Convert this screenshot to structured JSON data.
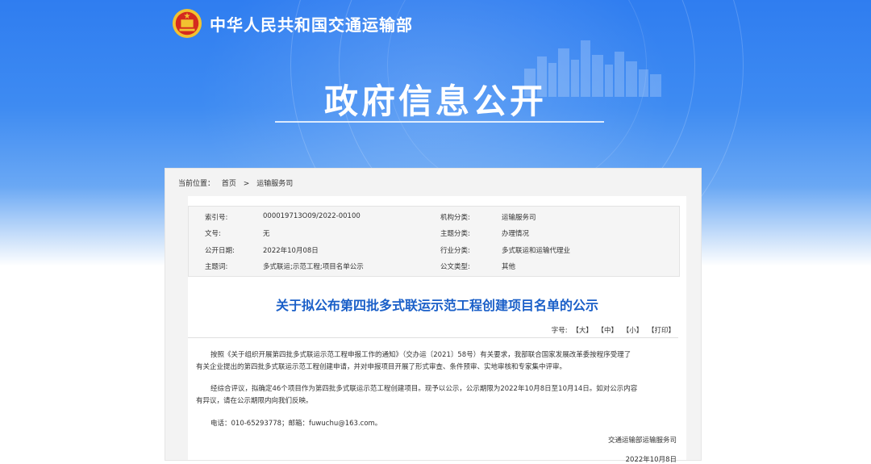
{
  "header": {
    "site_title": "中华人民共和国交通运输部",
    "big_title": "政府信息公开"
  },
  "breadcrumb": {
    "label": "当前位置：",
    "home": "首页",
    "separator": ">",
    "current": "运输服务司"
  },
  "meta": {
    "index_label": "索引号:",
    "index_value": "000019713O09/2022-00100",
    "org_label": "机构分类:",
    "org_value": "运输服务司",
    "docno_label": "文号:",
    "docno_value": "无",
    "topic_label": "主题分类:",
    "topic_value": "办理情况",
    "date_label": "公开日期:",
    "date_value": "2022年10月08日",
    "industry_label": "行业分类:",
    "industry_value": "多式联运和运输代理业",
    "keywords_label": "主题词:",
    "keywords_value": "多式联运;示范工程;项目名单公示",
    "doctype_label": "公文类型:",
    "doctype_value": "其他"
  },
  "document": {
    "title": "关于拟公布第四批多式联运示范工程创建项目名单的公示",
    "font_size_label": "字号:",
    "font_large": "【大】",
    "font_medium": "【中】",
    "font_small": "【小】",
    "print": "【打印】",
    "para1_line1": "按照《关于组织开展第四批多式联运示范工程申报工作的通知》（交办运〔2021〕58号）有关要求，我部联合国家发展改革委按程序受理了",
    "para1_line2": "有关企业提出的第四批多式联运示范工程创建申请，并对申报项目开展了形式审查、条件预审、实地审核和专家集中评审。",
    "para2_line1": "经综合评议，拟确定46个项目作为第四批多式联运示范工程创建项目。现予以公示，公示期限为2022年10月8日至10月14日。如对公示内容",
    "para2_line2": "有异议，请在公示期限内向我们反映。",
    "contact": "电话：010-65293778；邮箱：fuwuchu@163.com。",
    "signature": "交通运输部运输服务司",
    "sign_date": "2022年10月8日"
  },
  "colors": {
    "hero_blue": "#2f7df0",
    "title_blue": "#1a5fc8",
    "emblem_red": "#d42a1f",
    "emblem_gold": "#f2c230"
  }
}
